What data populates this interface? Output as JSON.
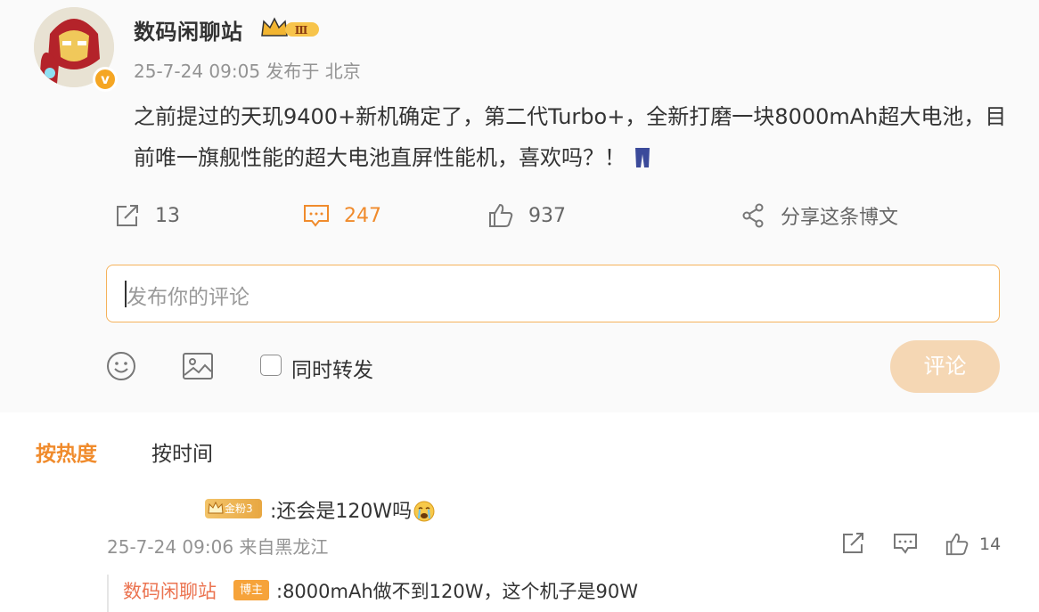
{
  "post": {
    "username": "数码闲聊站",
    "level_badge": "Ⅲ",
    "verified_icon": "v",
    "meta": "25-7-24 09:05 发布于 北京",
    "text": "之前提过的天玑9400+新机确定了，第二代Turbo+，全新打磨一块8000mAh超大电池，目前唯一旗舰性能的超大电池直屏性能机，喜欢吗？！",
    "actions": {
      "reposts": "13",
      "comments": "247",
      "likes": "937",
      "share_label": "分享这条博文"
    }
  },
  "composer": {
    "placeholder": "发布你的评论",
    "repost_label": "同时转发",
    "submit_label": "评论"
  },
  "sort": {
    "hot": "按热度",
    "time": "按时间"
  },
  "comments": [
    {
      "fan_badge": "金粉3",
      "text": ":还会是120W吗",
      "meta": "25-7-24 09:06 来自黑龙江",
      "likes": "14",
      "reply": {
        "user": "数码闲聊站",
        "tag": "博主",
        "text": ":8000mAh做不到120W，这个机子是90W"
      }
    }
  ],
  "colors": {
    "accent": "#f08b2c",
    "link_orange": "#eb7350",
    "submit_disabled": "#f5d7b4",
    "border": "#f5b25b"
  },
  "icons": [
    "avatar",
    "verified-v-icon",
    "crown-badge-icon",
    "pants-emoji-icon",
    "repost-icon",
    "comment-icon",
    "like-icon",
    "share-icon",
    "emoji-icon",
    "image-icon",
    "crying-emoji-icon"
  ]
}
